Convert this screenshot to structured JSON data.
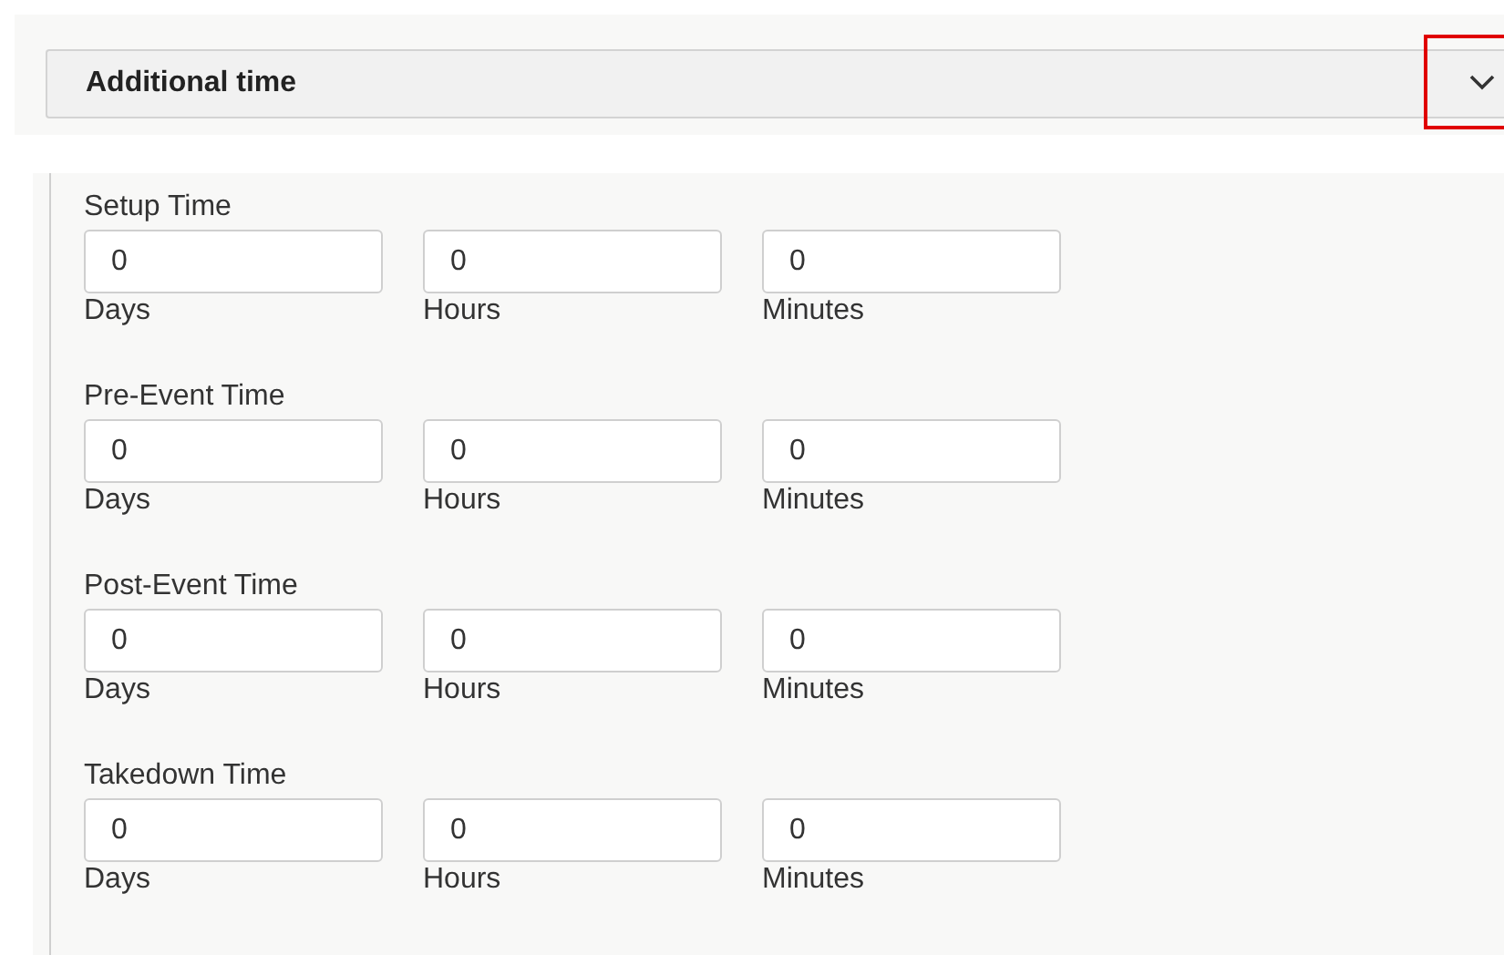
{
  "section": {
    "title": "Additional time",
    "expanded": true
  },
  "groups": [
    {
      "label": "Setup Time",
      "fields": [
        {
          "value": "0",
          "unit": "Days"
        },
        {
          "value": "0",
          "unit": "Hours"
        },
        {
          "value": "0",
          "unit": "Minutes"
        }
      ]
    },
    {
      "label": "Pre-Event Time",
      "fields": [
        {
          "value": "0",
          "unit": "Days"
        },
        {
          "value": "0",
          "unit": "Hours"
        },
        {
          "value": "0",
          "unit": "Minutes"
        }
      ]
    },
    {
      "label": "Post-Event Time",
      "fields": [
        {
          "value": "0",
          "unit": "Days"
        },
        {
          "value": "0",
          "unit": "Hours"
        },
        {
          "value": "0",
          "unit": "Minutes"
        }
      ]
    },
    {
      "label": "Takedown Time",
      "fields": [
        {
          "value": "0",
          "unit": "Days"
        },
        {
          "value": "0",
          "unit": "Hours"
        },
        {
          "value": "0",
          "unit": "Minutes"
        }
      ]
    }
  ]
}
